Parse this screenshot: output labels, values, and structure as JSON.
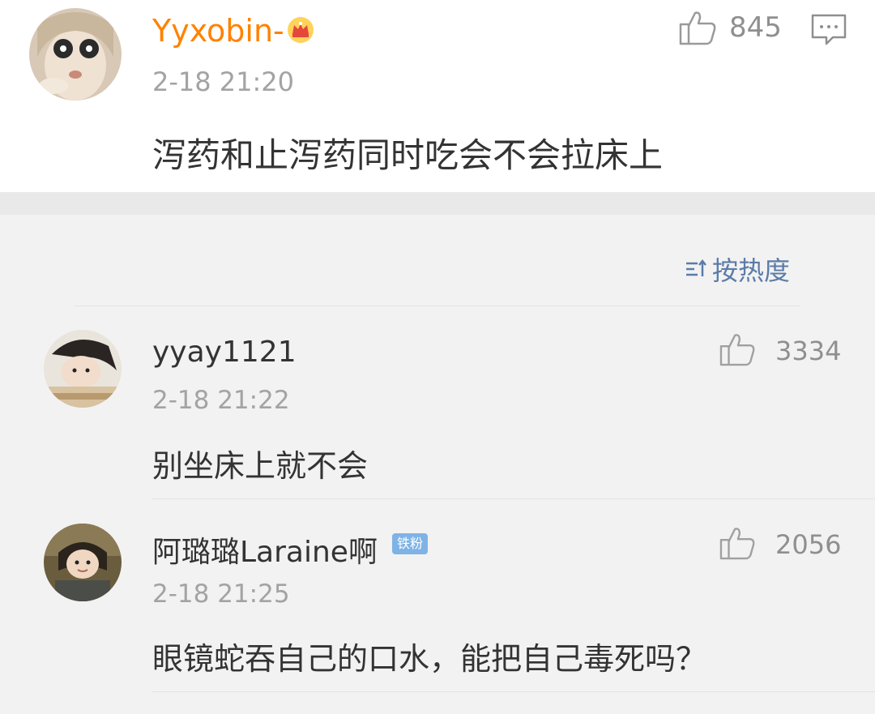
{
  "post": {
    "username": "Yyxobin-",
    "time": "2-18 21:20",
    "likes": "845",
    "text": "泻药和止泻药同时吃会不会拉床上",
    "avatar_icon": "avatar-icon",
    "vip_icon": "crown-icon"
  },
  "sort": {
    "label": "按热度",
    "icon": "sort-icon"
  },
  "comments": [
    {
      "username": "yyay1121",
      "time": "2-18 21:22",
      "likes": "3334",
      "text": "别坐床上就不会"
    },
    {
      "username": "阿璐璐Laraine啊",
      "badge": "铁粉",
      "time": "2-18 21:25",
      "likes": "2056",
      "text": "眼镜蛇吞自己的口水，能把自己毒死吗？"
    }
  ],
  "colors": {
    "vip_name": "#ff8200",
    "link_blue": "#5b7ca8",
    "badge": "#7fb3e6"
  }
}
